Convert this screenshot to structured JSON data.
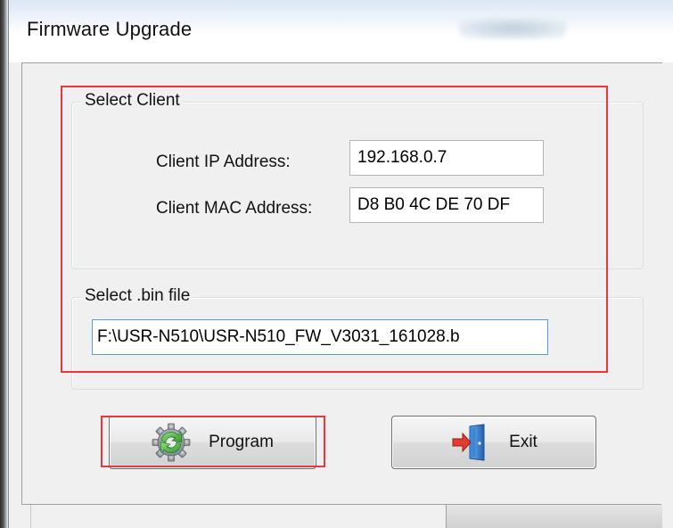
{
  "window": {
    "title": "Firmware Upgrade"
  },
  "select_client": {
    "legend": "Select Client",
    "ip_label": "Client IP Address:",
    "ip_value": "192.168.0.7",
    "mac_label": "Client MAC Address:",
    "mac_value": "D8 B0 4C DE 70 DF"
  },
  "select_bin": {
    "legend": "Select .bin file",
    "path_value": "F:\\USR-N510\\USR-N510_FW_V3031_161028.b"
  },
  "buttons": {
    "program_label": "Program",
    "program_icon": "gear-refresh-icon",
    "exit_label": "Exit",
    "exit_icon": "exit-door-icon"
  },
  "colors": {
    "annotation": "#e8383d",
    "focus_border": "#569de5"
  }
}
